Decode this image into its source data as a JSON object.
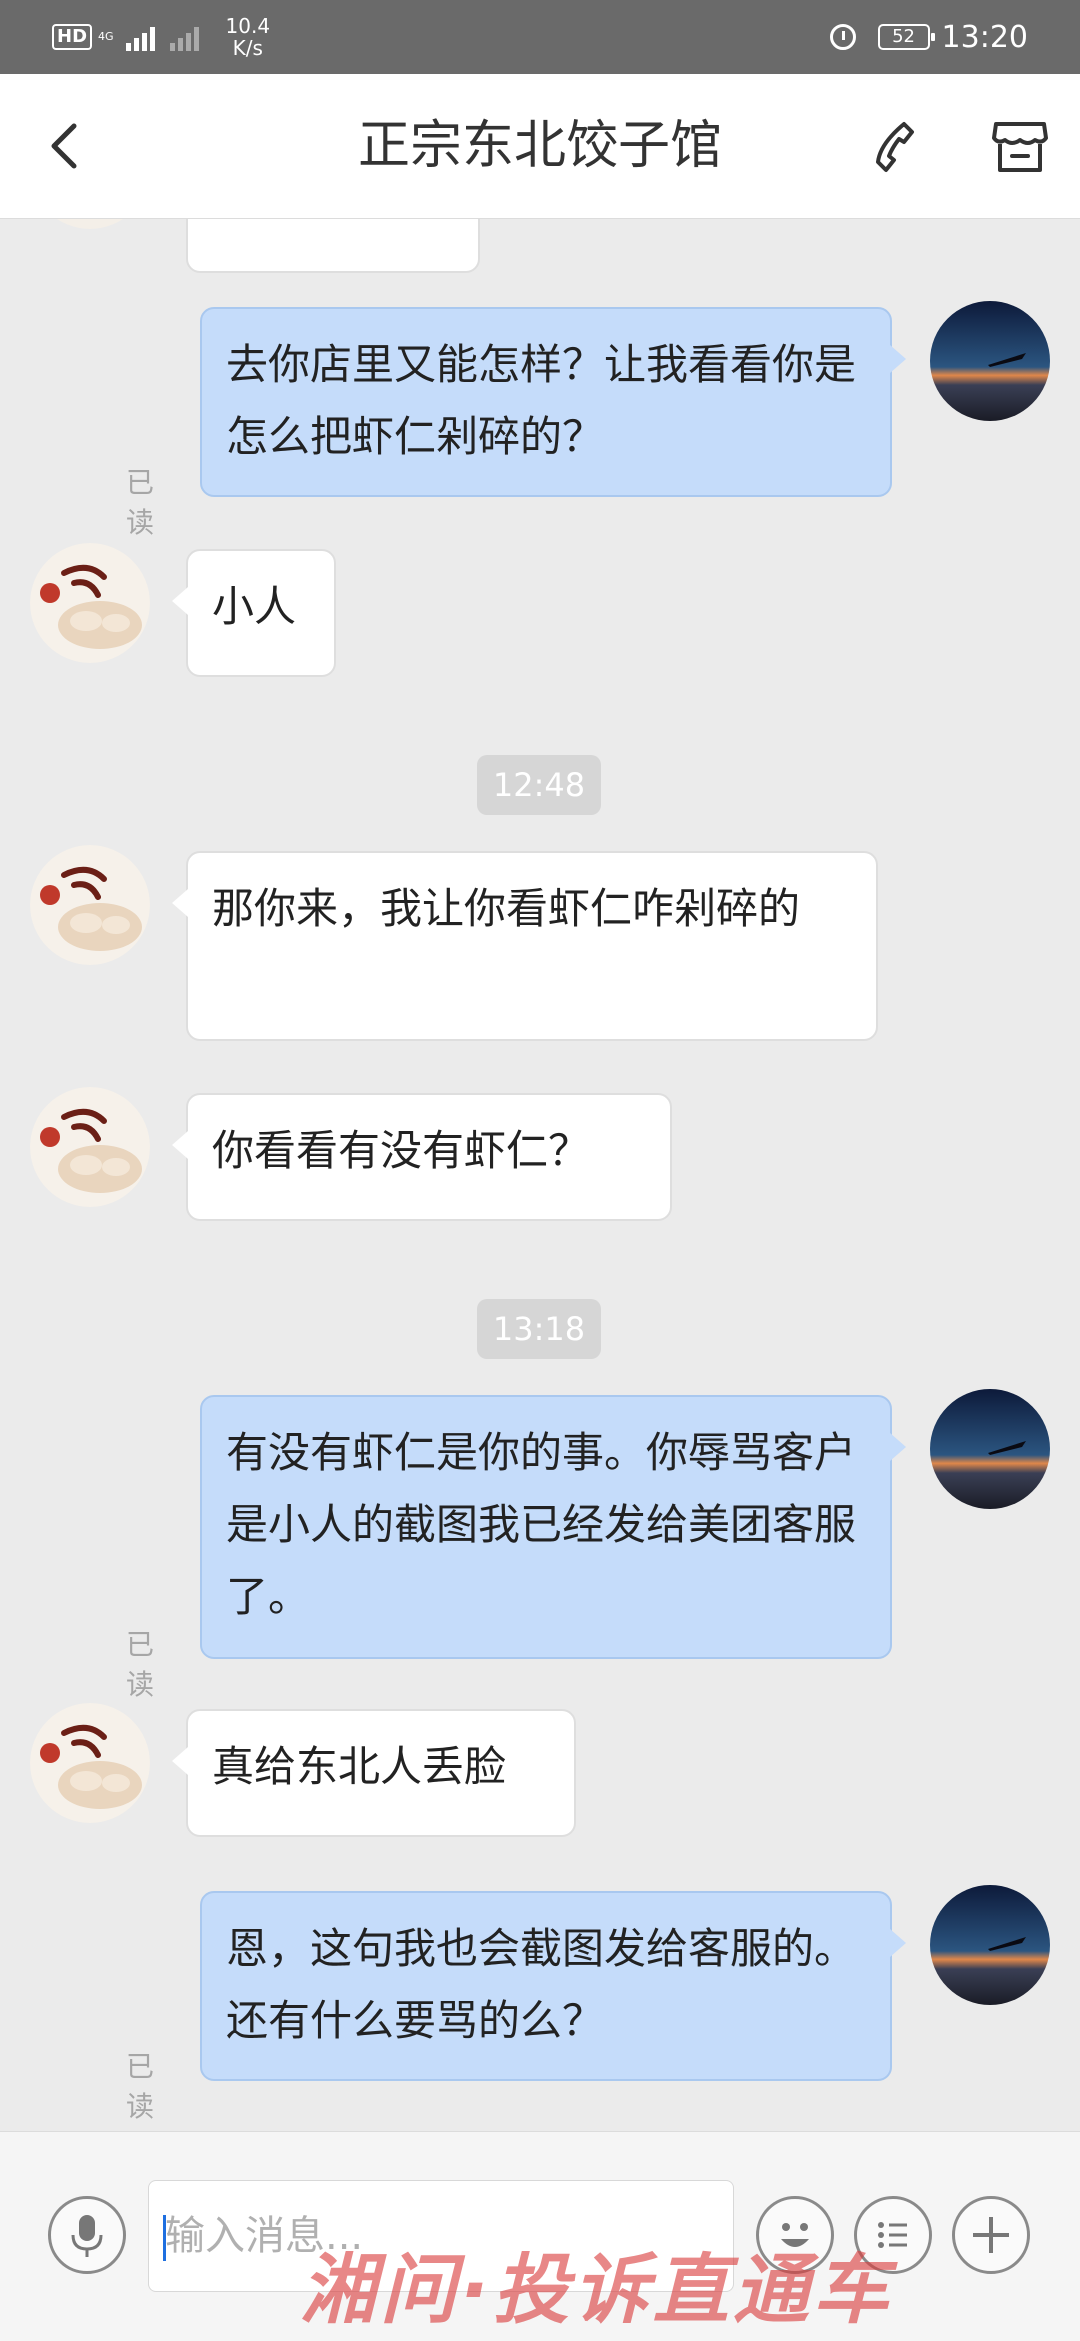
{
  "status_bar": {
    "network_badge": "HD",
    "network_type": "4G",
    "speed_value": "10.4",
    "speed_unit": "K/s",
    "battery": "52",
    "time": "13:20"
  },
  "header": {
    "title": "正宗东北饺子馆",
    "back_icon": "chevron-left-icon",
    "call_icon": "phone-icon",
    "shop_icon": "shop-icon"
  },
  "messages": [
    {
      "side": "in",
      "text": ""
    },
    {
      "side": "out",
      "text": "去你店里又能怎样？让我看看你是怎么把虾仁剁碎的？",
      "read_label": "已读"
    },
    {
      "side": "in",
      "text": "小人"
    },
    {
      "type": "timestamp",
      "text": "12:48"
    },
    {
      "side": "in",
      "text": "那你来，我让你看虾仁咋剁碎的"
    },
    {
      "side": "in",
      "text": "你看看有没有虾仁？"
    },
    {
      "type": "timestamp",
      "text": "13:18"
    },
    {
      "side": "out",
      "text": "有没有虾仁是你的事。你辱骂客户是小人的截图我已经发给美团客服了。",
      "read_label": "已读"
    },
    {
      "side": "in",
      "text": "真给东北人丢脸"
    },
    {
      "side": "out",
      "text": "恩，这句我也会截图发给客服的。还有什么要骂的么？",
      "read_label": "已读"
    }
  ],
  "input_bar": {
    "placeholder": "输入消息...",
    "voice_icon": "microphone-icon",
    "emoji_icon": "emoji-icon",
    "menu_icon": "list-icon",
    "plus_icon": "plus-icon"
  },
  "watermark": "湘问·投诉直通车"
}
